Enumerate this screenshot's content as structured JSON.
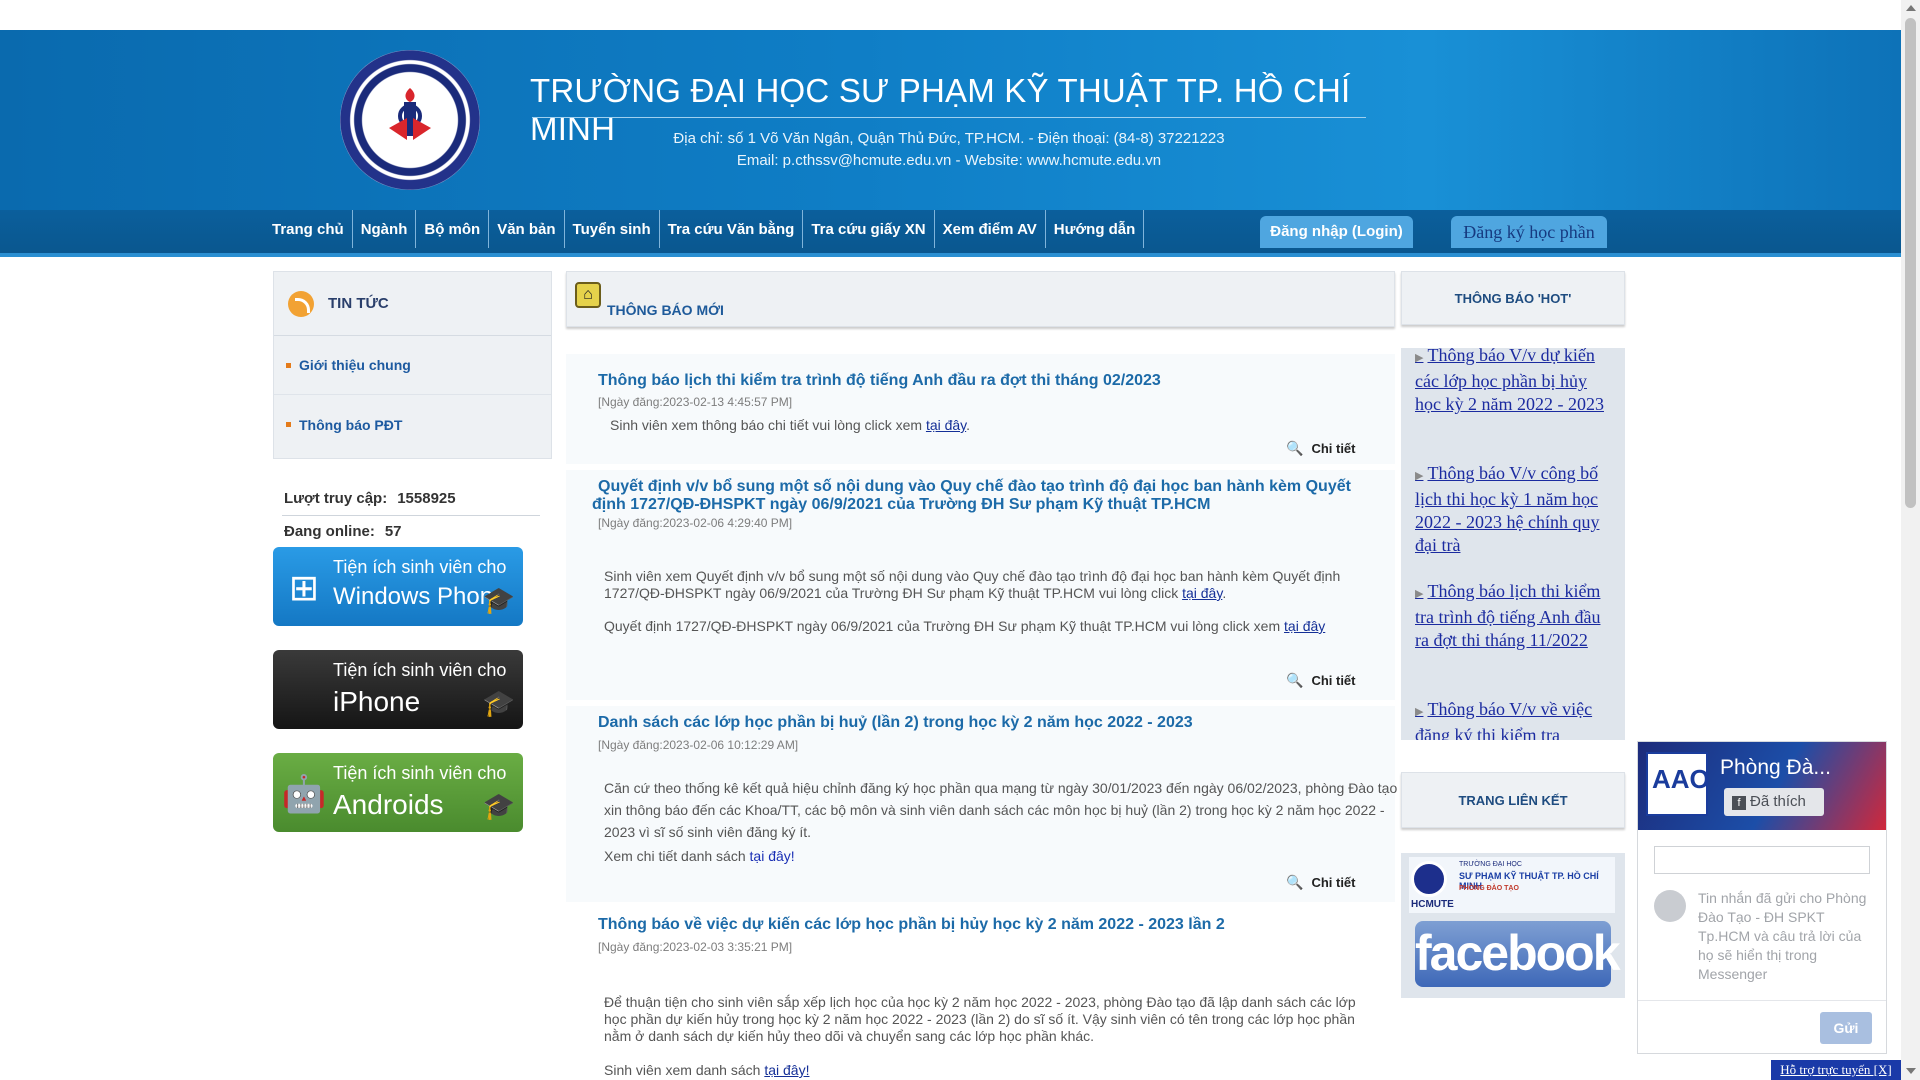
{
  "header": {
    "title": "TRƯỜNG ĐẠI HỌC SƯ PHẠM KỸ THUẬT TP. HỒ CHÍ MINH",
    "address": "Địa chỉ: số 1 Võ Văn Ngân, Quận Thủ Đức, TP.HCM. - Điện thoại: (84-8) 37221223",
    "contact": "Email: p.cthssv@hcmute.edu.vn  - Website: www.hcmute.edu.vn"
  },
  "nav": {
    "items": [
      "Trang chủ",
      "Ngành",
      "Bộ môn",
      "Văn bản",
      "Tuyển sinh",
      "Tra cứu Văn bằng",
      "Tra cứu giấy XN",
      "Xem điểm AV",
      "Hướng dẫn"
    ],
    "login": "Đăng nhập (Login)",
    "register": "Đăng ký học phần"
  },
  "sidebar": {
    "title": "TIN TỨC",
    "items": [
      "Giới thiệu chung",
      "Thông báo PĐT"
    ],
    "visits_label": "Lượt truy cập:",
    "visits": "1558925",
    "online_label": "Đang online:",
    "online": "57",
    "apps": [
      {
        "small": "Tiện ích sinh viên cho",
        "big": "Windows Phone",
        "color": "#1a8ad6"
      },
      {
        "small": "Tiện ích sinh viên cho",
        "big": "iPhone",
        "color": "#222222"
      },
      {
        "small": "Tiện ích sinh viên cho",
        "big": "Androids",
        "color": "#5b9a3c"
      }
    ]
  },
  "main": {
    "title": "THÔNG BÁO MỚI",
    "detail_label": "Chi tiết",
    "news": [
      {
        "title": "Thông báo lịch thi kiểm tra trình độ tiếng Anh đầu ra đợt thi tháng 02/2023",
        "date": "[Ngày đăng:2023-02-13 4:45:57 PM]",
        "body": "Sinh viên xem thông báo chi tiết vui lòng click xem",
        "link": "tại đây"
      },
      {
        "title_l1": "Quyết định v/v bổ sung một số nội dung vào Quy chế đào tạo trình độ đại học ban hành kèm Quyết",
        "title_l2": "định 1727/QĐ-ĐHSPKT ngày 06/9/2021 của Trường ĐH Sư phạm Kỹ thuật TP.HCM",
        "date": "[Ngày đăng:2023-02-06 4:29:40 PM]",
        "body1": "Sinh viên xem Quyết định v/v bổ sung một số nội dung vào Quy chế đào tạo trình độ đại học ban hành kèm Quyết định 1727/QĐ-ĐHSPKT ngày 06/9/2021 của Trường ĐH Sư phạm Kỹ thuật TP.HCM vui lòng click",
        "link1": "tại đây",
        "body2": "Quyết định 1727/QĐ-ĐHSPKT ngày 06/9/2021 của Trường ĐH Sư phạm Kỹ thuật TP.HCM vui lòng click xem",
        "link2": "tại đây"
      },
      {
        "title": "Danh sách các lớp học phần bị huỷ (lần 2) trong học kỳ 2 năm học 2022 - 2023",
        "date": "[Ngày đăng:2023-02-06 10:12:29 AM]",
        "body": "Căn cứ theo thống kê kết quả hiệu chỉnh đăng ký học phần qua mạng từ ngày 30/01/2023 đến ngày 06/02/2023, phòng Đào tạo xin thông báo đến các Khoa/TT, các bộ môn và sinh viên danh sách các môn học bị huỷ (lần 2) trong học kỳ 2 năm học 2022 - 2023 vì sĩ số sinh viên đăng ký ít.",
        "body2": "Xem chi tiết danh sách",
        "link": "tại đây!"
      },
      {
        "title": "Thông báo về việc dự kiến các lớp học phần bị hủy học kỳ 2 năm 2022 - 2023 lần 2",
        "date": "[Ngày đăng:2023-02-03 3:35:21 PM]",
        "body": "Để thuận tiện cho sinh viên sắp xếp lịch học của học kỳ 2 năm học 2022 - 2023, phòng Đào tạo đã lập danh sách các lớp học phần dự kiến hủy trong học kỳ 2 năm học 2022 - 2023 (lần 2) do sĩ số ít. Vậy sinh viên có tên trong các lớp học phần nằm ở danh sách dự kiến hủy theo dõi và chuyển sang các lớp học phần khác.",
        "body2": "Sinh viên xem danh sách",
        "link": "tại đây!"
      }
    ]
  },
  "right": {
    "hot_title": "THÔNG BÁO 'HOT'",
    "hot_items": [
      "Thông báo V/v dự kiến các lớp học phần bị hủy học kỳ 2 năm 2022 - 2023",
      "Thông báo V/v công bố lịch thi học kỳ 1 năm học 2022 - 2023 hệ chính quy đại trà",
      "Thông báo lịch thi kiểm tra trình độ tiếng Anh đầu ra đợt thi tháng 11/2022",
      "Thông báo V/v về việc đăng ký thi kiểm tra"
    ],
    "links_title": "TRANG LIÊN KẾT",
    "logo_line1": "TRƯỜNG ĐẠI HỌC",
    "logo_line2": "SƯ PHẠM KỸ THUẬT TP. HỒ CHÍ MINH",
    "logo_line3": "PHÒNG ĐÀO TẠO",
    "logo_hcmute": "HCMUTE",
    "facebook": "facebook"
  },
  "messenger": {
    "page_name": "Phòng Đà...",
    "like_label": "Đã thích",
    "logo_text": "AAO",
    "info": "Tin nhắn đã gửi cho Phòng Đào Tạo - ĐH SPKT Tp.HCM và câu trả lời của họ sẽ hiển thị trong Messenger",
    "send": "Gửi"
  },
  "support": "Hỗ trợ trực tuyến [X]"
}
